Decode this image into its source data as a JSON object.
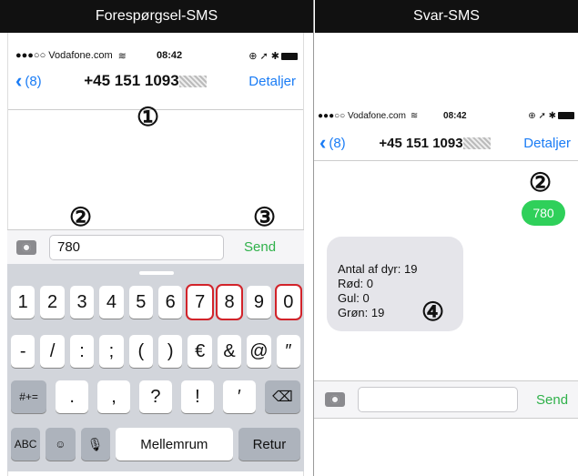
{
  "left_panel": {
    "header": "Forespørgsel-SMS",
    "status": {
      "carrier": "●●●○○ Vodafone.com",
      "time": "08:42",
      "icons": "⊕ ➚ ✱"
    },
    "nav": {
      "back": "(8)",
      "phone": "+45 151 1093",
      "details": "Detaljer"
    },
    "callouts": {
      "one": "①",
      "two": "②",
      "three": "③"
    },
    "input": {
      "value": "780",
      "send": "Send"
    },
    "keyboard": {
      "row1": [
        "1",
        "2",
        "3",
        "4",
        "5",
        "6",
        "7",
        "8",
        "9",
        "0"
      ],
      "row2": [
        "-",
        "/",
        ":",
        ";",
        "(",
        ")",
        "€",
        "&",
        "@",
        "″"
      ],
      "row3": [
        "#+=",
        ".",
        ",",
        "?",
        "!",
        "′",
        "⌫"
      ],
      "row4": {
        "abc": "ABC",
        "emoji": "☺",
        "mic": "🎙",
        "space": "Mellemrum",
        "return": "Retur"
      },
      "highlighted_keys": [
        "7",
        "8",
        "0"
      ]
    }
  },
  "right_panel": {
    "header": "Svar-SMS",
    "status": {
      "carrier": "●●●○○ Vodafone.com",
      "time": "08:42",
      "icons": "⊕ ➚ ✱"
    },
    "nav": {
      "back": "(8)",
      "phone": "+45 151 1093",
      "details": "Detaljer"
    },
    "callouts": {
      "two": "②",
      "four": "④"
    },
    "sent_message": "780",
    "reply_lines": [
      "Antal af dyr: 19",
      "Rød: 0",
      "Gul: 0",
      "Grøn: 19"
    ],
    "input": {
      "value": "",
      "send": "Send"
    }
  }
}
